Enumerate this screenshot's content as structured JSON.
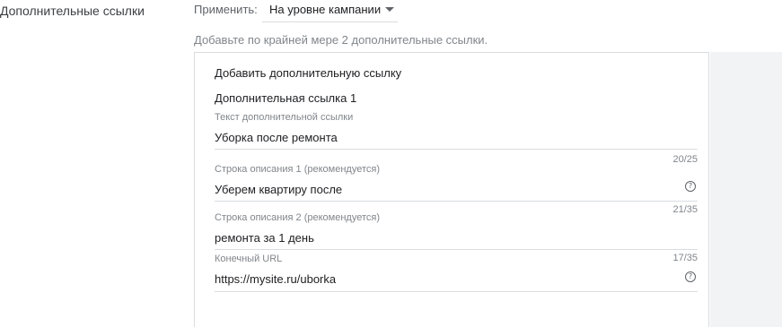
{
  "section": {
    "title": "Дополнительные ссылки"
  },
  "apply": {
    "label": "Применить:",
    "selected": "На уровне кампании"
  },
  "hint": "Добавьте по крайней мере 2 дополнительные ссылки.",
  "card": {
    "title": "Добавить дополнительную ссылку",
    "sitelink_heading": "Дополнительная ссылка 1",
    "fields": [
      {
        "label": "Текст дополнительной ссылки",
        "value": "Уборка после ремонта",
        "counter": "20/25"
      },
      {
        "label": "Строка описания 1 (рекомендуется)",
        "value": "Уберем квартиру после",
        "counter": "21/35",
        "help_icon": "help-circle-icon"
      },
      {
        "label": "Строка описания 2 (рекомендуется)",
        "value": "ремонта за 1 день",
        "counter": "17/35"
      },
      {
        "label": "Конечный URL",
        "value": "https://mysite.ru/uborka",
        "help_icon": "help-circle-icon"
      }
    ]
  },
  "colors": {
    "side_panel": "#f1f3f4",
    "border": "#dadce0",
    "muted_text": "#80868b"
  }
}
